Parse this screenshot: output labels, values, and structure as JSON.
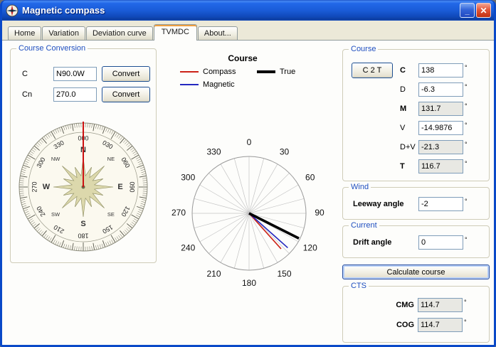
{
  "window": {
    "title": "Magnetic compass",
    "minimize_glyph": "_",
    "close_glyph": "✕"
  },
  "tabs": [
    {
      "label": "Home",
      "active": false
    },
    {
      "label": "Variation",
      "active": false
    },
    {
      "label": "Deviation curve",
      "active": false
    },
    {
      "label": "TVMDC",
      "active": true
    },
    {
      "label": "About...",
      "active": false
    }
  ],
  "course_conversion": {
    "title": "Course Conversion",
    "rows": [
      {
        "label": "C",
        "value": "N90.0W",
        "button_label": "Convert"
      },
      {
        "label": "Cn",
        "value": "270.0",
        "button_label": "Convert"
      }
    ]
  },
  "compass_rose": {
    "degree_labels": [
      "000",
      "030",
      "060",
      "090",
      "120",
      "150",
      "180",
      "210",
      "240",
      "270",
      "300",
      "330"
    ],
    "cardinal_labels": [
      "N",
      "NE",
      "E",
      "SE",
      "S",
      "SW",
      "W",
      "NW"
    ],
    "needle_deg": 0,
    "needle_color": "#cc1111"
  },
  "chart_data": {
    "type": "polar-line",
    "title": "Course",
    "zero_position": "top",
    "direction": "clockwise",
    "grid_step_deg": 15,
    "radial_axis_max": 1,
    "angle_tick_labels": [
      "0",
      "30",
      "60",
      "90",
      "120",
      "150",
      "180",
      "210",
      "240",
      "270",
      "300",
      "330"
    ],
    "legend_position": "top",
    "series": [
      {
        "name": "Compass",
        "angle_deg": 138,
        "length": 0.84,
        "color": "#cc2218",
        "width": 1.6
      },
      {
        "name": "Magnetic",
        "angle_deg": 131.7,
        "length": 0.91,
        "color": "#2428c0",
        "width": 1.6
      },
      {
        "name": "True",
        "angle_deg": 116.7,
        "length": 0.98,
        "color": "#000000",
        "width": 3.6
      }
    ]
  },
  "course_panel": {
    "title": "Course",
    "c2t_button_label": "C 2 T",
    "unit": "°",
    "rows": [
      {
        "label": "C",
        "value": "138"
      },
      {
        "label": "D",
        "value": "-6.3"
      },
      {
        "label": "M",
        "value": "131.7"
      },
      {
        "label": "V",
        "value": "-14.9876"
      },
      {
        "label": "D+V",
        "value": "-21.3"
      },
      {
        "label": "T",
        "value": "116.7"
      }
    ]
  },
  "wind_panel": {
    "title": "Wind",
    "label": "Leeway angle",
    "value": "-2",
    "unit": "°"
  },
  "current_panel": {
    "title": "Current",
    "label": "Drift angle",
    "value": "0",
    "unit": "°"
  },
  "calculate_button_label": "Calculate course",
  "cts_panel": {
    "title": "CTS",
    "unit": "°",
    "rows": [
      {
        "label": "CMG",
        "value": "114.7"
      },
      {
        "label": "COG",
        "value": "114.7"
      }
    ]
  }
}
